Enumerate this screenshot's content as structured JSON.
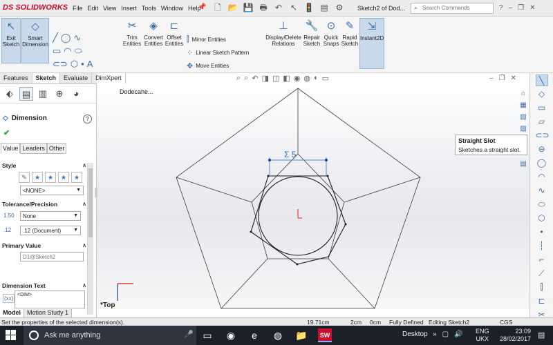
{
  "app": {
    "logo_prefix": "DS",
    "logo_name": "SOLIDWORKS",
    "doc_title": "Sketch2 of Dod...",
    "search_placeholder": "Search Commands"
  },
  "menu": [
    "File",
    "Edit",
    "View",
    "Insert",
    "Tools",
    "Window",
    "Help"
  ],
  "command_manager": {
    "exit_sketch": [
      "Exit",
      "Sketch"
    ],
    "smart_dimension": [
      "Smart",
      "Dimension"
    ],
    "trim_entities": [
      "Trim",
      "Entities"
    ],
    "convert_entities": [
      "Convert",
      "Entities"
    ],
    "offset_entities": [
      "Offset",
      "Entities"
    ],
    "mirror_entities": "Mirror Entities",
    "linear_sketch_pattern": "Linear Sketch Pattern",
    "move_entities": "Move Entities",
    "display_delete_relations": [
      "Display/Delete",
      "Relations"
    ],
    "repair_sketch": [
      "Repair",
      "Sketch"
    ],
    "quick_snaps": [
      "Quick",
      "Snaps"
    ],
    "rapid_sketch": [
      "Rapid",
      "Sketch"
    ],
    "instant2d": "Instant2D"
  },
  "cm_tabs": [
    "Features",
    "Sketch",
    "Evaluate",
    "DimXpert"
  ],
  "cm_tabs_selected": "Sketch",
  "feature_tree": {
    "part_name": "Dodecahe..."
  },
  "property_manager": {
    "title": "Dimension",
    "tabs": [
      "Value",
      "Leaders",
      "Other"
    ],
    "selected_tab": "Value",
    "style": {
      "heading": "Style",
      "dropdown": "<NONE>"
    },
    "tolerance": {
      "heading": "Tolerance/Precision",
      "tolerance_value": "None",
      "precision_value": ".12 (Document)",
      "icon1": "1.50\n.01",
      "icon2": "1.50\n.01"
    },
    "primary_value": {
      "heading": "Primary Value",
      "name": "D1@Sketch2"
    },
    "dimension_text": {
      "heading": "Dimension Text",
      "value": "<DIM>",
      "icon": "(xx)"
    }
  },
  "sketch": {
    "dimension_label": "Σ 5",
    "view_label": "*Top"
  },
  "tooltip": {
    "title": "Straight Slot",
    "description": "Sketches a straight slot."
  },
  "bottom_tabs": [
    "Model",
    "Motion Study 1"
  ],
  "bottom_tabs_selected": "Model",
  "status": {
    "message": "Set the properties of the selected dimension(s).",
    "x": "19.71cm",
    "y": "2cm",
    "z": "0cm",
    "state": "Fully Defined",
    "mode": "Editing Sketch2",
    "units": "CGS"
  },
  "taskbar": {
    "search_placeholder": "Ask me anything",
    "desktop_label": "Desktop",
    "lang1": "ENG",
    "lang2": "UKX",
    "time": "23:09",
    "date": "28/02/2017",
    "sw_badge": "SW"
  }
}
